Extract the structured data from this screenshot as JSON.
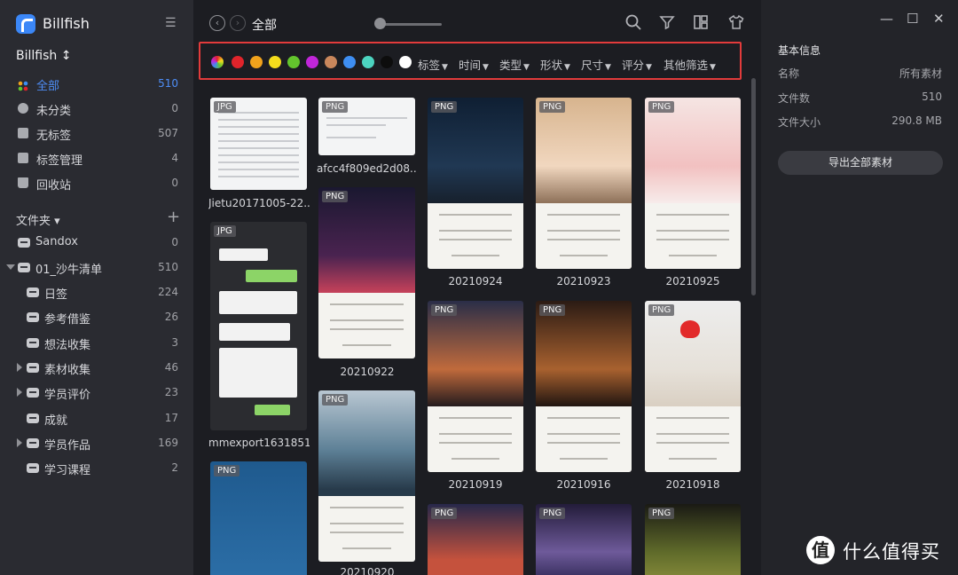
{
  "app": {
    "title": "Billfish",
    "library": "Billfish ↕"
  },
  "sidebar": {
    "items": [
      {
        "label": "全部",
        "count": "510"
      },
      {
        "label": "未分类",
        "count": "0"
      },
      {
        "label": "无标签",
        "count": "507"
      },
      {
        "label": "标签管理",
        "count": "4"
      },
      {
        "label": "回收站",
        "count": "0"
      }
    ],
    "folders_label": "文件夹 ▾",
    "folders_add": "+",
    "folders": [
      {
        "label": "Sandox",
        "count": "0"
      },
      {
        "label": "01_沙牛清单",
        "count": "510"
      },
      {
        "label": "日签",
        "count": "224"
      },
      {
        "label": "参考借鉴",
        "count": "26"
      },
      {
        "label": "想法收集",
        "count": "3"
      },
      {
        "label": "素材收集",
        "count": "46"
      },
      {
        "label": "学员评价",
        "count": "23"
      },
      {
        "label": "成就",
        "count": "17"
      },
      {
        "label": "学员作品",
        "count": "169"
      },
      {
        "label": "学习课程",
        "count": "2"
      }
    ]
  },
  "toolbar": {
    "breadcrumb": "全部",
    "back": "‹",
    "forward": "›"
  },
  "filters": {
    "colors": [
      "multicolor",
      "#e0242b",
      "#f0a21c",
      "#f4dc1c",
      "#63c52d",
      "#c126d9",
      "#c9875c",
      "#3e8ef2",
      "#4cd4c0",
      "#0d0d0d",
      "#ffffff"
    ],
    "dropdowns": [
      "标签",
      "时间",
      "类型",
      "形状",
      "尺寸",
      "评分",
      "其他筛选"
    ]
  },
  "assets": [
    {
      "badge": "JPG",
      "name": "Jietu20171005-22..."
    },
    {
      "badge": "JPG",
      "name": "mmexport1631851..."
    },
    {
      "badge": "PNG",
      "name": ""
    },
    {
      "badge": "PNG",
      "name": "afcc4f809ed2d08..."
    },
    {
      "badge": "PNG",
      "name": "20210922"
    },
    {
      "badge": "PNG",
      "name": "20210920"
    },
    {
      "badge": "PNG",
      "name": "20210924"
    },
    {
      "badge": "PNG",
      "name": "20210919"
    },
    {
      "badge": "PNG",
      "name": ""
    },
    {
      "badge": "PNG",
      "name": "20210923"
    },
    {
      "badge": "PNG",
      "name": "20210916"
    },
    {
      "badge": "PNG",
      "name": ""
    },
    {
      "badge": "PNG",
      "name": "20210925"
    },
    {
      "badge": "PNG",
      "name": "20210918"
    },
    {
      "badge": "PNG",
      "name": ""
    }
  ],
  "info": {
    "title": "基本信息",
    "rows": [
      {
        "label": "名称",
        "value": "所有素材"
      },
      {
        "label": "文件数",
        "value": "510"
      },
      {
        "label": "文件大小",
        "value": "290.8 MB"
      }
    ],
    "export_button": "导出全部素材"
  },
  "window": {
    "minimize": "—",
    "maximize": "☐",
    "close": "✕"
  },
  "watermark": {
    "logo": "值",
    "text": "什么值得买"
  }
}
